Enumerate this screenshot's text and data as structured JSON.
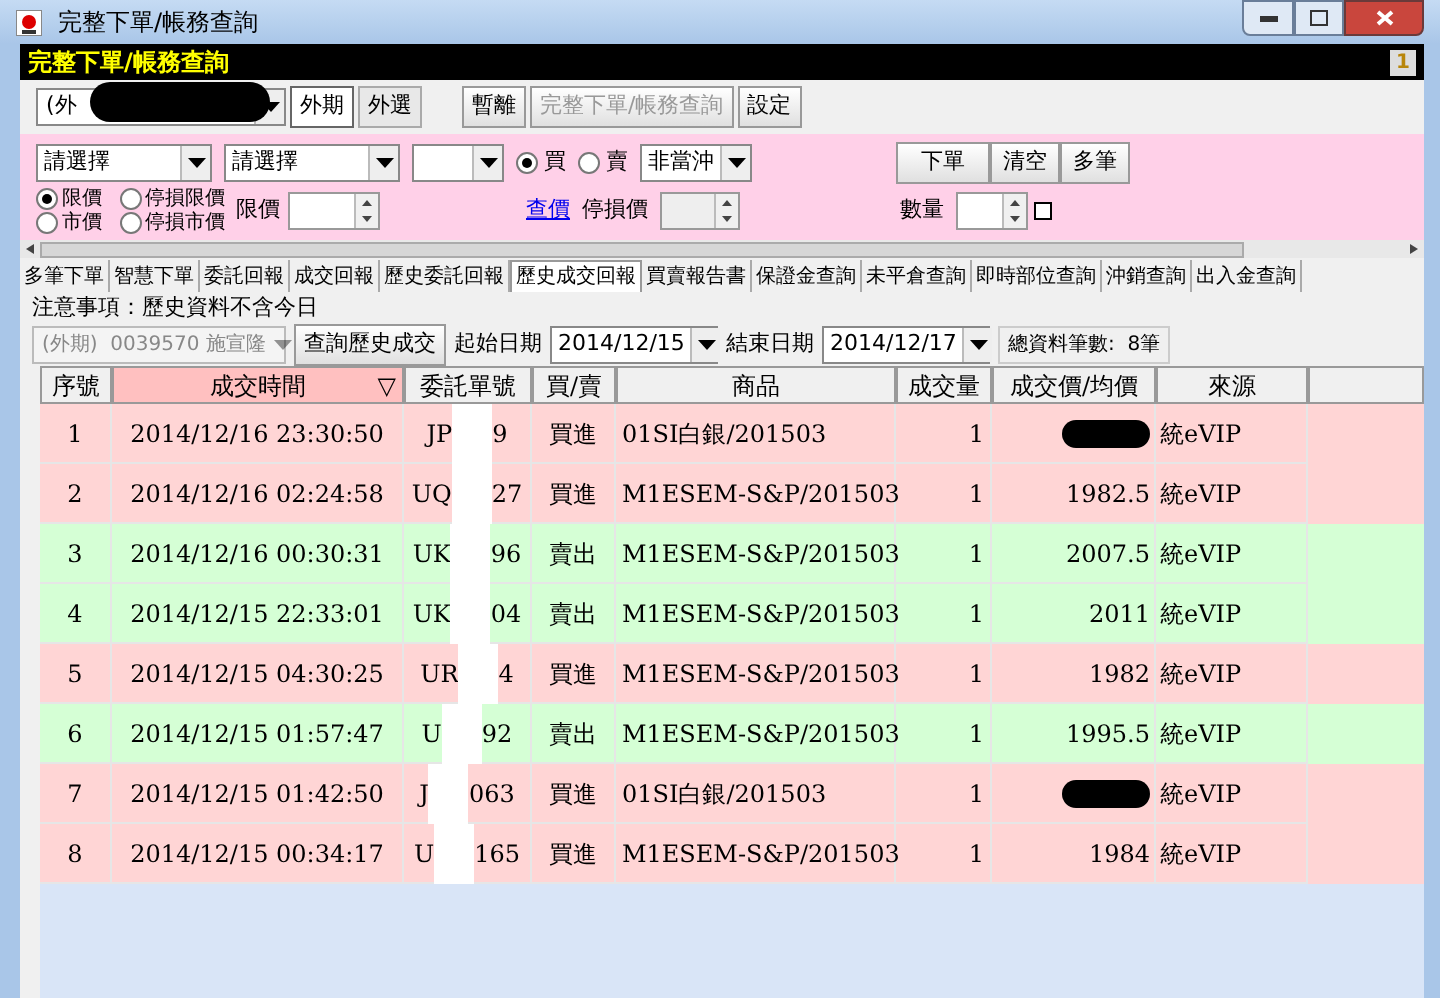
{
  "window": {
    "title": "完整下單/帳務查詢"
  },
  "header": {
    "title": "完整下單/帳務查詢",
    "badge": "1"
  },
  "toolbar": {
    "account_prefix": "(外",
    "market_tabs": [
      {
        "label": "外期",
        "selected": true
      },
      {
        "label": "外選",
        "selected": false
      }
    ],
    "buttons": [
      {
        "label": "暫離",
        "disabled": false
      },
      {
        "label": "完整下單/帳務查詢",
        "disabled": true
      },
      {
        "label": "設定",
        "disabled": false
      }
    ]
  },
  "order_form": {
    "selects": [
      "請選擇",
      "請選擇"
    ],
    "side_options": [
      {
        "label": "買",
        "selected": true
      },
      {
        "label": "賣",
        "selected": false
      }
    ],
    "offset_select": "非當沖",
    "price_types": [
      {
        "label": "限價",
        "selected": true
      },
      {
        "label": "停損限價",
        "selected": false
      },
      {
        "label": "市價",
        "selected": false
      },
      {
        "label": "停損市價",
        "selected": false
      }
    ],
    "limit_price_label": "限價",
    "quote_link": "查價",
    "stop_price_label": "停損價",
    "quantity_label": "數量",
    "quantity_checkbox": {
      "checked": false
    },
    "action_buttons": [
      "下單",
      "清空",
      "多筆"
    ]
  },
  "tabs": [
    {
      "label": "多筆下單",
      "selected": false
    },
    {
      "label": "智慧下單",
      "selected": false
    },
    {
      "label": "委託回報",
      "selected": false
    },
    {
      "label": "成交回報",
      "selected": false
    },
    {
      "label": "歷史委託回報",
      "selected": false
    },
    {
      "label": "歷史成交回報",
      "selected": true
    },
    {
      "label": "買賣報告書",
      "selected": false
    },
    {
      "label": "保證金查詢",
      "selected": false
    },
    {
      "label": "未平倉查詢",
      "selected": false
    },
    {
      "label": "即時部位查詢",
      "selected": false
    },
    {
      "label": "沖銷查詢",
      "selected": false
    },
    {
      "label": "出入金查詢",
      "selected": false
    }
  ],
  "notice": "注意事項：歷史資料不含今日",
  "filter": {
    "account": "(外期)  0039570 施宣隆",
    "query_button": "查詢歷史成交",
    "start_label": "起始日期",
    "start_date": "2014/12/15",
    "end_label": "結束日期",
    "end_date": "2014/12/17",
    "total": "總資料筆數:  8筆"
  },
  "table": {
    "columns": [
      {
        "label": "序號",
        "sorted": false
      },
      {
        "label": "成交時間",
        "sorted": true
      },
      {
        "label": "委託單號",
        "sorted": false
      },
      {
        "label": "買/賣",
        "sorted": false
      },
      {
        "label": "商品",
        "sorted": false
      },
      {
        "label": "成交量",
        "sorted": false
      },
      {
        "label": "成交價/均價",
        "sorted": false
      },
      {
        "label": "來源",
        "sorted": false
      }
    ],
    "sort_mark": "▽",
    "rows": [
      {
        "no": "1",
        "time": "2014/12/16 23:30:50",
        "order_head": "JP",
        "order_tail": "9",
        "side": "買進",
        "kind": "buy",
        "product": "01SI白銀/201503",
        "qty": "1",
        "price_redacted": true,
        "source": "統eVIP"
      },
      {
        "no": "2",
        "time": "2014/12/16 02:24:58",
        "order_head": "UQ",
        "order_tail": "27",
        "side": "買進",
        "kind": "buy",
        "product": "M1ESEM-S&P/201503",
        "qty": "1",
        "price": "1982.5",
        "price_redacted": false,
        "source": "統eVIP"
      },
      {
        "no": "3",
        "time": "2014/12/16 00:30:31",
        "order_head": "UK",
        "order_tail": "96",
        "side": "賣出",
        "kind": "sell",
        "product": "M1ESEM-S&P/201503",
        "qty": "1",
        "price": "2007.5",
        "price_redacted": false,
        "source": "統eVIP"
      },
      {
        "no": "4",
        "time": "2014/12/15 22:33:01",
        "order_head": "UK",
        "order_tail": "04",
        "side": "賣出",
        "kind": "sell",
        "product": "M1ESEM-S&P/201503",
        "qty": "1",
        "price": "2011",
        "price_redacted": false,
        "source": "統eVIP"
      },
      {
        "no": "5",
        "time": "2014/12/15 04:30:25",
        "order_head": "UR",
        "order_tail": "4",
        "side": "買進",
        "kind": "buy",
        "product": "M1ESEM-S&P/201503",
        "qty": "1",
        "price": "1982",
        "price_redacted": false,
        "source": "統eVIP"
      },
      {
        "no": "6",
        "time": "2014/12/15 01:57:47",
        "order_head": "U",
        "order_tail": "92",
        "side": "賣出",
        "kind": "sell",
        "product": "M1ESEM-S&P/201503",
        "qty": "1",
        "price": "1995.5",
        "price_redacted": false,
        "source": "統eVIP"
      },
      {
        "no": "7",
        "time": "2014/12/15 01:42:50",
        "order_head": "J",
        "order_tail": "063",
        "side": "買進",
        "kind": "buy",
        "product": "01SI白銀/201503",
        "qty": "1",
        "price_redacted": true,
        "source": "統eVIP"
      },
      {
        "no": "8",
        "time": "2014/12/15 00:34:17",
        "order_head": "U",
        "order_tail": "165",
        "side": "買進",
        "kind": "buy",
        "product": "M1ESEM-S&P/201503",
        "qty": "1",
        "price": "1984",
        "price_redacted": false,
        "source": "統eVIP"
      }
    ]
  }
}
